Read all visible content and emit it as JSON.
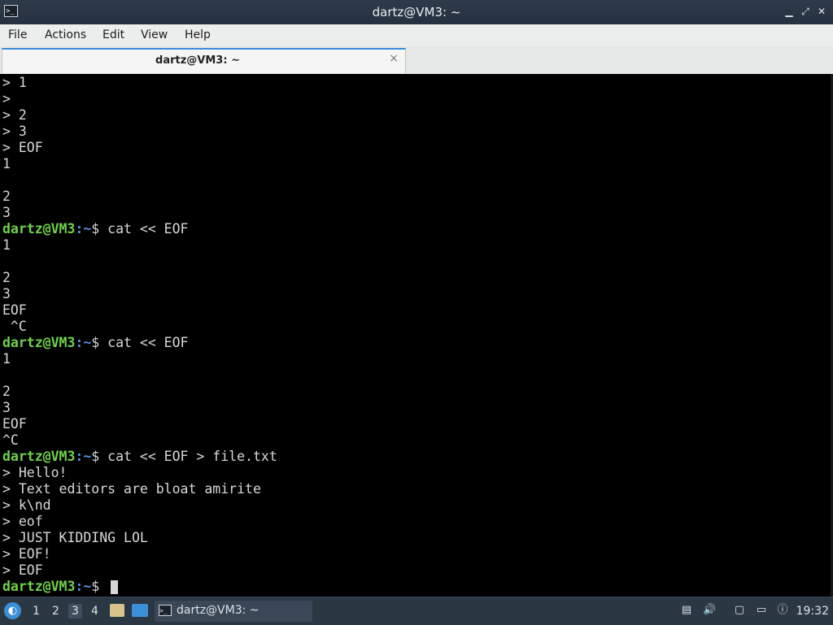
{
  "window": {
    "title": "dartz@VM3: ~",
    "app_icon": ">_"
  },
  "menu": [
    "File",
    "Actions",
    "Edit",
    "View",
    "Help"
  ],
  "tab": {
    "title": "dartz@VM3: ~",
    "close": "×"
  },
  "terminal": {
    "prompt_user": "dartz@VM3",
    "prompt_path": ":~",
    "lines": [
      "> 1",
      ">",
      "> 2",
      "> 3",
      "> EOF",
      "1",
      "",
      "2",
      "3",
      "$ cat << EOF",
      "1",
      "",
      "2",
      "3",
      "EOF",
      " ^C",
      "$ cat << EOF",
      "1",
      "",
      "2",
      "3",
      "EOF",
      "^C",
      "$ cat << EOF > file.txt",
      "> Hello!",
      "> Text editors are bloat amirite",
      "> k\\nd",
      "> eof",
      "> JUST KIDDING LOL",
      "> EOF!",
      "> EOF",
      "$ "
    ]
  },
  "taskbar": {
    "workspaces": [
      "1",
      "2",
      "3",
      "4"
    ],
    "active_workspace": "3",
    "task_label": "dartz@VM3: ~",
    "clock": "19:32"
  }
}
